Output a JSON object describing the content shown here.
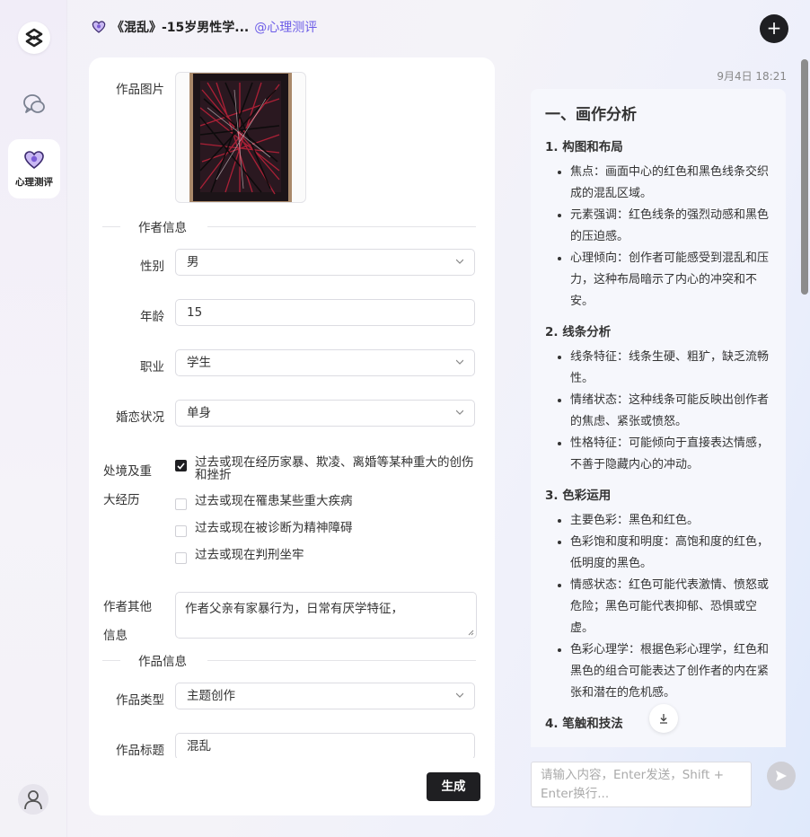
{
  "rail": {
    "eval_label": "心理测评"
  },
  "header": {
    "title": "《混乱》-15岁男性学...",
    "tag": "@心理测评"
  },
  "form": {
    "image_label": "作品图片",
    "author_section": "作者信息",
    "gender": {
      "label": "性别",
      "value": "男"
    },
    "age": {
      "label": "年龄",
      "value": "15"
    },
    "occupation": {
      "label": "职业",
      "value": "学生"
    },
    "marital": {
      "label": "婚恋状况",
      "value": "单身"
    },
    "experience_label_1": "处境及重",
    "experience_label_2": "大经历",
    "experiences": [
      {
        "text": "过去或现在经历家暴、欺凌、离婚等某种重大的创伤和挫折",
        "checked": true
      },
      {
        "text": "过去或现在罹患某些重大疾病",
        "checked": false
      },
      {
        "text": "过去或现在被诊断为精神障碍",
        "checked": false
      },
      {
        "text": "过去或现在判刑坐牢",
        "checked": false
      }
    ],
    "other_label_1": "作者其他",
    "other_label_2": "信息",
    "other_value": "作者父亲有家暴行为，日常有厌学特征，",
    "work_section": "作品信息",
    "work_type": {
      "label": "作品类型",
      "value": "主题创作"
    },
    "work_title": {
      "label": "作品标题",
      "value": "混乱"
    },
    "generate_label": "生成"
  },
  "response": {
    "time": "9月4日 18:21",
    "h1": "一、画作分析",
    "sections": [
      {
        "title": "1. 构图和布局",
        "items": [
          "焦点：画面中心的红色和黑色线条交织成的混乱区域。",
          "元素强调：红色线条的强烈动感和黑色的压迫感。",
          "心理倾向：创作者可能感受到混乱和压力，这种布局暗示了内心的冲突和不安。"
        ]
      },
      {
        "title": "2. 线条分析",
        "items": [
          "线条特征：线条生硬、粗犷，缺乏流畅性。",
          "情绪状态：这种线条可能反映出创作者的焦虑、紧张或愤怒。",
          "性格特征：可能倾向于直接表达情感，不善于隐藏内心的冲动。"
        ]
      },
      {
        "title": "3. 色彩运用",
        "items": [
          "主要色彩：黑色和红色。",
          "色彩饱和度和明度：高饱和度的红色，低明度的黑色。",
          "情感状态：红色可能代表激情、愤怒或危险；黑色可能代表抑郁、恐惧或空虚。",
          "色彩心理学：根据色彩心理学，红色和黑色的组合可能表达了创作者的内在紧张和潜在的危机感。"
        ]
      },
      {
        "title": "4. 笔触和技法",
        "items": []
      }
    ]
  },
  "chat": {
    "placeholder": "请输入内容，Enter发送，Shift + Enter换行..."
  },
  "colors": {
    "accent": "#6c5ce7",
    "dark_button": "#1f1f22"
  }
}
